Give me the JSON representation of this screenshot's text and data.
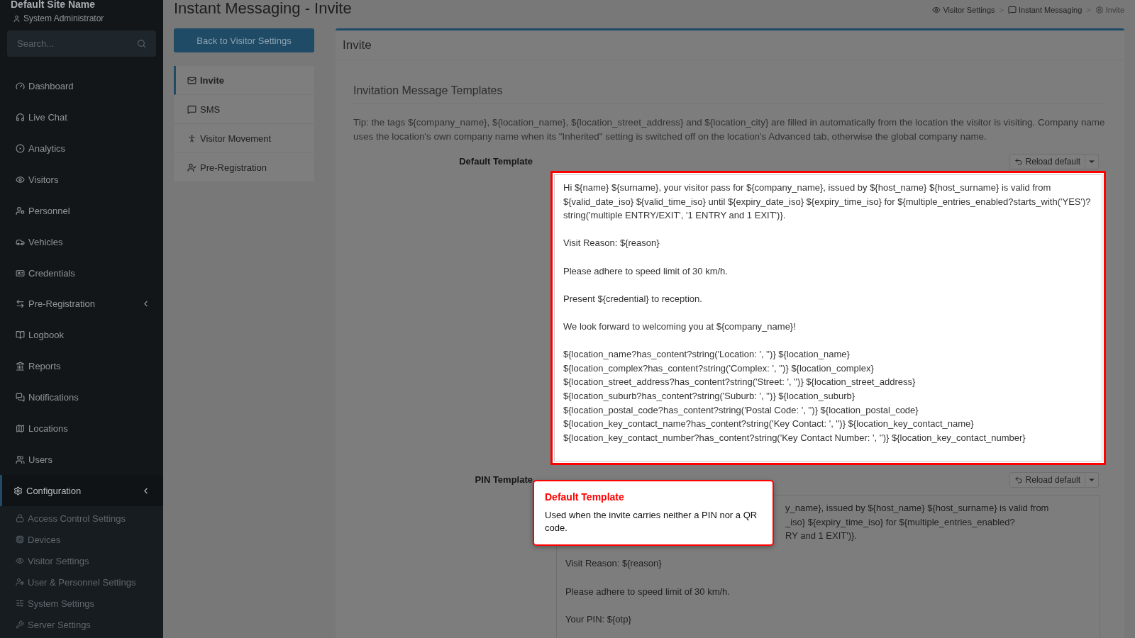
{
  "sidebar": {
    "site_name": "Default Site Name",
    "user": "System Administrator",
    "search": {
      "placeholder": "Search..."
    },
    "items": [
      {
        "label": "Dashboard",
        "selected": false,
        "kind": "link"
      },
      {
        "label": "Live Chat",
        "selected": false,
        "kind": "link"
      },
      {
        "label": "Analytics",
        "selected": false,
        "kind": "link"
      },
      {
        "label": "Visitors",
        "selected": false,
        "kind": "link"
      },
      {
        "label": "Personnel",
        "selected": false,
        "kind": "link"
      },
      {
        "label": "Vehicles",
        "selected": false,
        "kind": "link"
      },
      {
        "label": "Credentials",
        "selected": false,
        "kind": "link"
      },
      {
        "label": "Pre-Registration",
        "selected": false,
        "kind": "group"
      },
      {
        "label": "Logbook",
        "selected": false,
        "kind": "link"
      },
      {
        "label": "Reports",
        "selected": false,
        "kind": "link"
      },
      {
        "label": "Notifications",
        "selected": false,
        "kind": "link"
      },
      {
        "label": "Locations",
        "selected": false,
        "kind": "link"
      },
      {
        "label": "Users",
        "selected": false,
        "kind": "link"
      },
      {
        "label": "Configuration",
        "selected": true,
        "kind": "group",
        "children": [
          {
            "label": "Access Control Settings"
          },
          {
            "label": "Devices"
          },
          {
            "label": "Visitor Settings"
          },
          {
            "label": "User & Personnel Settings"
          },
          {
            "label": "System Settings"
          },
          {
            "label": "Server Settings"
          }
        ]
      }
    ]
  },
  "page": {
    "title": "Instant Messaging - Invite",
    "breadcrumb": [
      {
        "label": "Visitor Settings",
        "separator": ">"
      },
      {
        "label": "Instant Messaging",
        "separator": ">"
      },
      {
        "label": "Invite"
      }
    ],
    "back_button": "Back to Visitor Settings",
    "tabs": [
      {
        "label": "Invite",
        "selected": true
      },
      {
        "label": "SMS",
        "selected": false
      },
      {
        "label": "Visitor Movement",
        "selected": false
      },
      {
        "label": "Pre-Registration",
        "selected": false
      }
    ],
    "card": {
      "title": "Invite",
      "section_title": "Invitation Message Templates",
      "tip": "Tip: the tags ${company_name}, ${location_name}, ${location_street_address} and ${location_city} are filled in automatically from the location the visitor is visiting. Company name uses the location's own company name when its \"Inherited\" setting is switched off on the location's Advanced tab, otherwise the global company name.",
      "templates": [
        {
          "label": "Default Template",
          "reload_button": "Reload default",
          "highlighted": true,
          "text": "Hi ${name} ${surname}, your visitor pass for ${company_name}, issued by ${host_name} ${host_surname} is valid from ${valid_date_iso} ${valid_time_iso} until ${expiry_date_iso} ${expiry_time_iso} for ${multiple_entries_enabled?starts_with('YES')?string('multiple ENTRY/EXIT', '1 ENTRY and 1 EXIT')}.\n\nVisit Reason: ${reason}\n\nPlease adhere to speed limit of 30 km/h.\n\nPresent ${credential} to reception.\n\nWe look forward to welcoming you at ${company_name}!\n\n${location_name?has_content?string('Location: ', '')} ${location_name}\n${location_complex?has_content?string('Complex: ', '')} ${location_complex}\n${location_street_address?has_content?string('Street: ', '')} ${location_street_address}\n${location_suburb?has_content?string('Suburb: ', '')} ${location_suburb}\n${location_postal_code?has_content?string('Postal Code: ', '')} ${location_postal_code}\n${location_key_contact_name?has_content?string('Key Contact: ', '')} ${location_key_contact_name}\n${location_key_contact_number?has_content?string('Key Contact Number: ', '')} ${location_key_contact_number}"
        },
        {
          "label": "PIN Template",
          "reload_button": "Reload default",
          "highlighted": false,
          "covered_lines": [
            "y_name}, issued by ${host_name} ${host_surname} is valid from",
            "_iso} ${expiry_time_iso} for ${multiple_entries_enabled?",
            "RY and 1 EXIT')}."
          ],
          "text": "\nVisit Reason: ${reason}\n\nPlease adhere to speed limit of 30 km/h.\n\nYour PIN: ${otp}"
        }
      ]
    }
  },
  "popover": {
    "title": "Default Template",
    "body": "Used when the invite carries neither a PIN nor a QR code."
  }
}
